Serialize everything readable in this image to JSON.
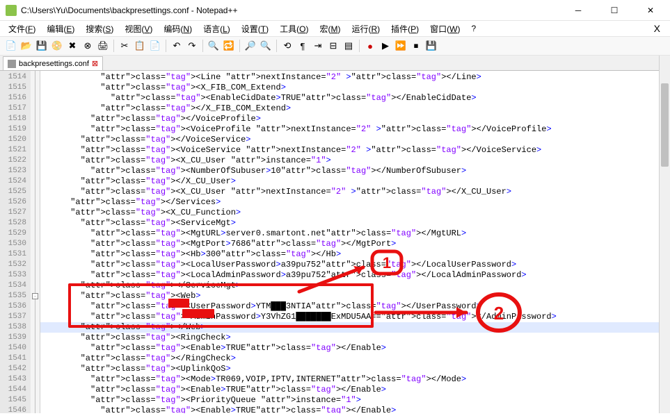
{
  "title": "C:\\Users\\Yu\\Documents\\backpresettings.conf - Notepad++",
  "menus": {
    "file": "文件(F)",
    "edit": "编辑(E)",
    "search": "搜索(S)",
    "view": "视图(V)",
    "encoding": "编码(N)",
    "language": "语言(L)",
    "settings": "设置(T)",
    "tools": "工具(O)",
    "macro": "宏(M)",
    "run": "运行(R)",
    "plugins": "插件(P)",
    "window": "窗口(W)",
    "help": "?"
  },
  "tab": {
    "name": "backpresettings.conf"
  },
  "lines": {
    "1514": "            <Line nextInstance=\"2\" ></Line>",
    "1515": "            <X_FIB_COM_Extend>",
    "1516": "              <EnableCidDate>TRUE</EnableCidDate>",
    "1517": "            </X_FIB_COM_Extend>",
    "1518": "          </VoiceProfile>",
    "1519": "          <VoiceProfile nextInstance=\"2\" ></VoiceProfile>",
    "1520": "        </VoiceService>",
    "1521": "        <VoiceService nextInstance=\"2\" ></VoiceService>",
    "1522": "        <X_CU_User instance=\"1\">",
    "1523": "          <NumberOfSubuser>10</NumberOfSubuser>",
    "1524": "        </X_CU_User>",
    "1525": "        <X_CU_User nextInstance=\"2\" ></X_CU_User>",
    "1526": "      </Services>",
    "1527": "      <X_CU_Function>",
    "1528": "        <ServiceMgt>",
    "1529": "          <MgtURL>server0.smartont.net</MgtURL>",
    "1530": "          <MgtPort>7686</MgtPort>",
    "1531": "          <Hb>300</Hb>",
    "1532": "          <LocalUserPassword>a39pu752</LocalUserPassword>",
    "1533": "          <LocalAdminPassword>a39pu752</LocalAdminPassword>",
    "1534": "        </ServiceMgt>",
    "1535": "        <Web>",
    "1536": "          <UserPassword>YTM███3NTIA</UserPassword>",
    "1537": "          <AdminPassword>Y3VhZG1███████ExMDU5AA==</AdminPassword>",
    "1538": "        </Web>",
    "1539": "        <RingCheck>",
    "1540": "          <Enable>TRUE</Enable>",
    "1541": "        </RingCheck>",
    "1542": "        <UplinkQoS>",
    "1543": "          <Mode>TR069,VOIP,IPTV,INTERNET</Mode>",
    "1544": "          <Enable>TRUE</Enable>",
    "1545": "          <PriorityQueue instance=\"1\">",
    "1546": "            <Enable>TRUE</Enable>"
  },
  "line_numbers": [
    "1514",
    "1515",
    "1516",
    "1517",
    "1518",
    "1519",
    "1520",
    "1521",
    "1522",
    "1523",
    "1524",
    "1525",
    "1526",
    "1527",
    "1528",
    "1529",
    "1530",
    "1531",
    "1532",
    "1533",
    "1534",
    "1535",
    "1536",
    "1537",
    "1538",
    "1539",
    "1540",
    "1541",
    "1542",
    "1543",
    "1544",
    "1545",
    "1546"
  ],
  "annotations": {
    "one": "1",
    "two": "2"
  },
  "colors": {
    "annot": "#e81010"
  }
}
